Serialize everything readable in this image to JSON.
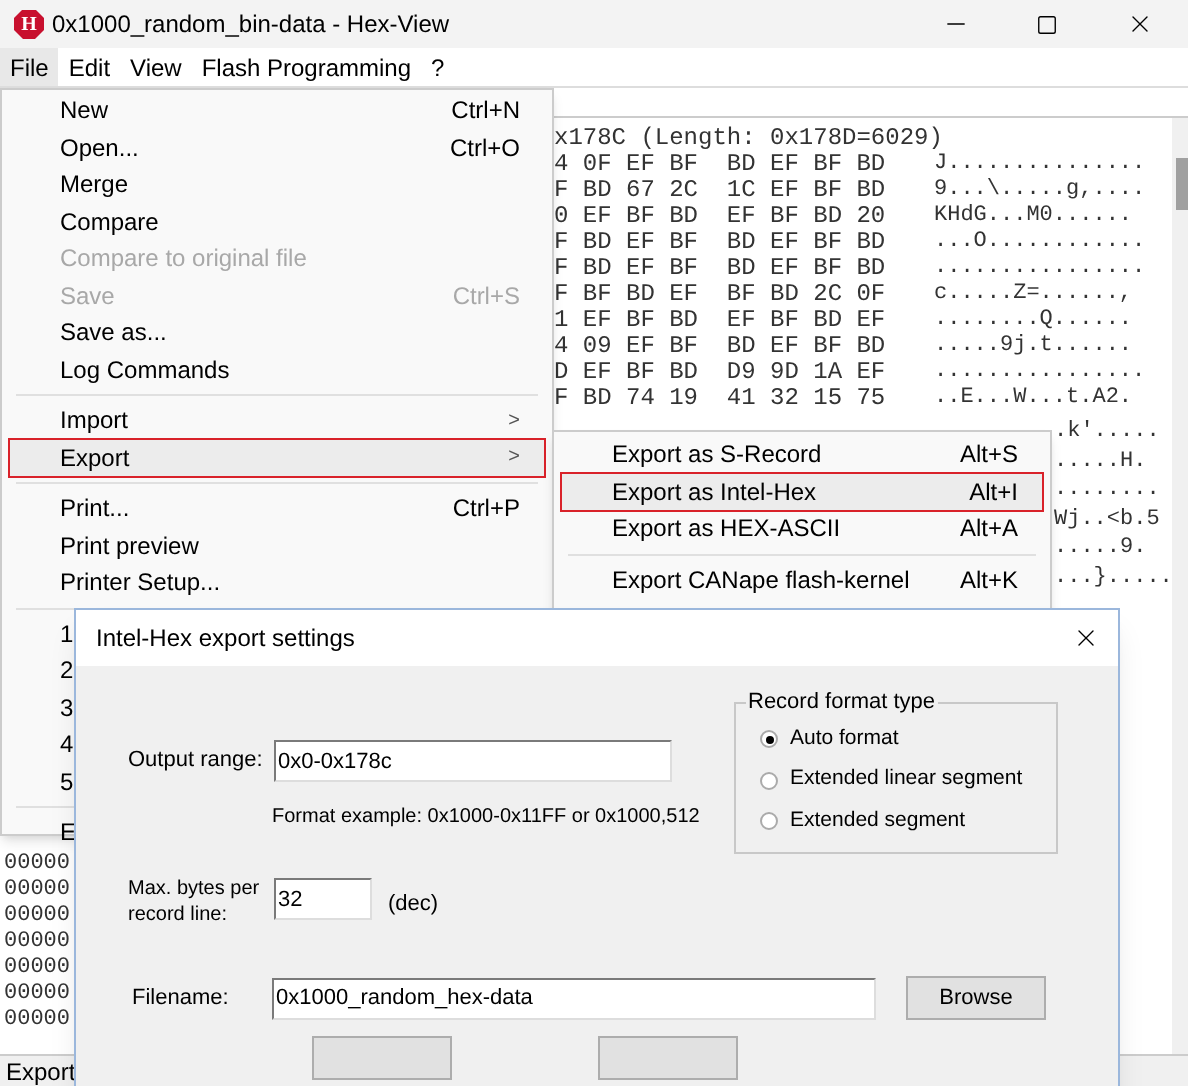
{
  "window": {
    "title": "0x1000_random_bin-data - Hex-View",
    "app_icon_letter": "H"
  },
  "menubar": [
    {
      "label": "File",
      "selected": true
    },
    {
      "label": "Edit",
      "selected": false
    },
    {
      "label": "View",
      "selected": false
    },
    {
      "label": "Flash Programming",
      "selected": false
    },
    {
      "label": "?",
      "selected": false
    }
  ],
  "hex_view": {
    "header": "x178C (Length: 0x178D=6029)",
    "rows": [
      {
        "bytes": "4 0F EF BF  BD EF BF BD",
        "ascii": "J..............."
      },
      {
        "bytes": "F BD 67 2C  1C EF BF BD",
        "ascii": "9...\\.....g,...."
      },
      {
        "bytes": "0 EF BF BD  EF BF BD 20",
        "ascii": "KHdG...M0......"
      },
      {
        "bytes": "F BD EF BF  BD EF BF BD",
        "ascii": "...O............"
      },
      {
        "bytes": "F BD EF BF  BD EF BF BD",
        "ascii": "................"
      },
      {
        "bytes": "F BF BD EF  BF BD 2C 0F",
        "ascii": "c.....Z=......,"
      },
      {
        "bytes": "1 EF BF BD  EF BF BD EF",
        "ascii": "........Q......"
      },
      {
        "bytes": "4 09 EF BF  BD EF BF BD",
        "ascii": ".....9j.t......"
      },
      {
        "bytes": "D EF BF BD  D9 9D 1A EF",
        "ascii": "................"
      },
      {
        "bytes": "F BD 74 19  41 32 15 75",
        "ascii": "..E...W...t.A2."
      }
    ],
    "ascii_fragments": [
      ".k'.....",
      ".....H.",
      "........",
      "Wj..<b.5",
      ".....9.",
      "...}....."
    ],
    "left_fragments": [
      "00000",
      "00000",
      "00000",
      "00000",
      "00000",
      "00000",
      "00000"
    ]
  },
  "status_bar": "Export",
  "file_menu": [
    {
      "kind": "item",
      "label": "New",
      "shortcut": "Ctrl+N",
      "disabled": false,
      "selected": false
    },
    {
      "kind": "item",
      "label": "Open...",
      "shortcut": "Ctrl+O",
      "disabled": false,
      "selected": false
    },
    {
      "kind": "item",
      "label": "Merge",
      "disabled": false,
      "selected": false
    },
    {
      "kind": "item",
      "label": "Compare",
      "disabled": false,
      "selected": false
    },
    {
      "kind": "item",
      "label": "Compare to original file",
      "disabled": true,
      "selected": false
    },
    {
      "kind": "item",
      "label": "Save",
      "shortcut": "Ctrl+S",
      "disabled": true,
      "selected": false
    },
    {
      "kind": "item",
      "label": "Save as...",
      "disabled": false,
      "selected": false
    },
    {
      "kind": "item",
      "label": "Log Commands",
      "disabled": false,
      "selected": false
    },
    {
      "kind": "separator"
    },
    {
      "kind": "submenu",
      "label": "Import",
      "arrow": ">",
      "disabled": false,
      "selected": false
    },
    {
      "kind": "submenu",
      "label": "Export",
      "arrow": ">",
      "disabled": false,
      "selected": true
    },
    {
      "kind": "separator"
    },
    {
      "kind": "item",
      "label": "Print...",
      "shortcut": "Ctrl+P",
      "disabled": false,
      "selected": false
    },
    {
      "kind": "item",
      "label": "Print preview",
      "disabled": false,
      "selected": false
    },
    {
      "kind": "item",
      "label": "Printer Setup...",
      "disabled": false,
      "selected": false
    },
    {
      "kind": "separator"
    },
    {
      "kind": "item",
      "label": "1",
      "disabled": false,
      "selected": false
    },
    {
      "kind": "item",
      "label": "2",
      "disabled": false,
      "selected": false
    },
    {
      "kind": "item",
      "label": "3",
      "disabled": false,
      "selected": false
    },
    {
      "kind": "item",
      "label": "4",
      "disabled": false,
      "selected": false
    },
    {
      "kind": "item",
      "label": "5",
      "disabled": false,
      "selected": false
    },
    {
      "kind": "separator"
    },
    {
      "kind": "item",
      "label": "E",
      "disabled": false,
      "selected": false
    }
  ],
  "export_submenu": [
    {
      "kind": "item",
      "label": "Export as S-Record",
      "shortcut": "Alt+S",
      "selected": false
    },
    {
      "kind": "item",
      "label": "Export as Intel-Hex",
      "shortcut": "Alt+I",
      "selected": true
    },
    {
      "kind": "item",
      "label": "Export as HEX-ASCII",
      "shortcut": "Alt+A",
      "selected": false
    },
    {
      "kind": "separator"
    },
    {
      "kind": "item",
      "label": "Export CANape flash-kernel",
      "shortcut": "Alt+K",
      "selected": false
    }
  ],
  "dialog": {
    "title": "Intel-Hex export settings",
    "output_range": {
      "label": "Output range:",
      "value": "0x0-0x178c"
    },
    "format_example": "Format example: 0x1000-0x11FF or 0x1000,512",
    "max_bytes": {
      "label": "Max. bytes per record line:",
      "value": "32",
      "unit": "(dec)"
    },
    "filename": {
      "label": "Filename:",
      "value": "0x1000_random_hex-data"
    },
    "browse": "Browse",
    "record_format": {
      "title": "Record format type",
      "options": [
        {
          "label": "Auto format",
          "selected": true
        },
        {
          "label": "Extended linear segment",
          "selected": false
        },
        {
          "label": "Extended segment",
          "selected": false
        }
      ]
    }
  }
}
